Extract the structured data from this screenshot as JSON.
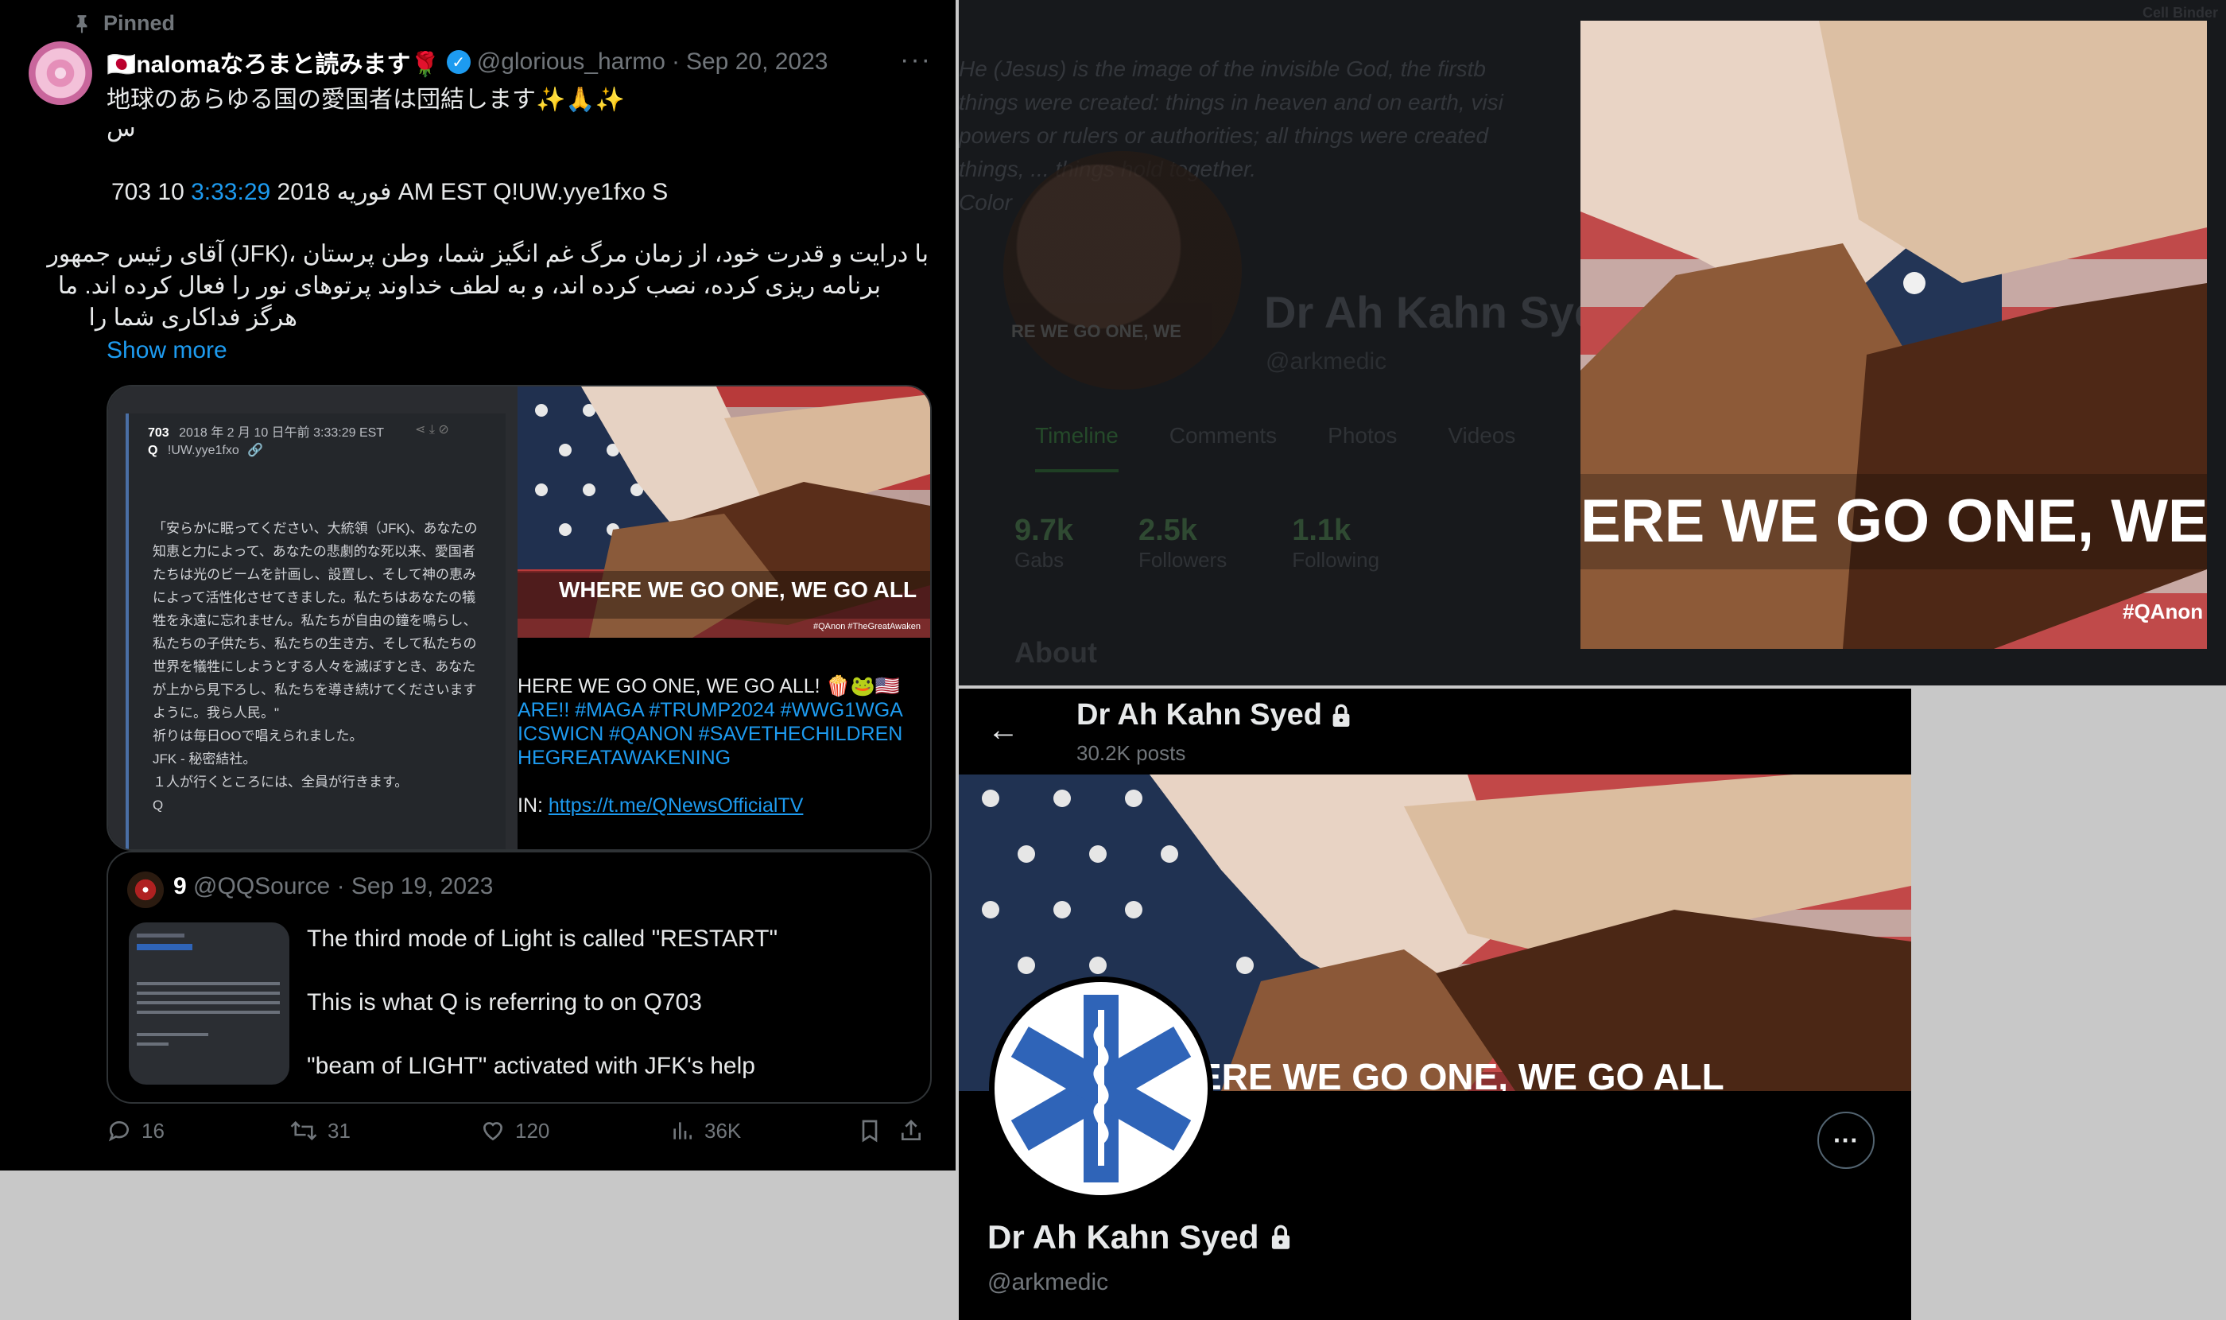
{
  "tweet": {
    "pinned_label": "Pinned",
    "author_name": "🇯🇵nalomaなろまと読みます🌹",
    "handle": "@glorious_harmo",
    "date_sep": "·",
    "date": "Sep 20, 2023",
    "more": "···",
    "line1": "地球のあらゆる国の愛国者は団結します✨🙏✨",
    "line2": "س",
    "line3_pre": "703 10 ",
    "line3_time": "3:33:29",
    "line3_post": " 2018 فوریه AM EST Q!UW.yye1fxo S",
    "persian1": "با درایت و قدرت خود، از زمان مرگ غم انگیز شما، وطن پرستان ،(JFK) آقای رئیس جمهور",
    "persian2": "برنامه ریزی کرده، نصب کرده اند، و به لطف خداوند پرتوهای نور را فعال کرده اند. ما",
    "persian3": "هرگز فداکاری شما را",
    "show_more": "Show more",
    "qdrop": {
      "post_no": "703",
      "timestamp": "2018 年 2 月 10 日午前 3:33:29 EST",
      "author": "Q",
      "trip": "!UW.yye1fxo",
      "lines": [
        "「安らかに眠ってください、大統領（JFK)、あなたの",
        "知恵と力によって、あなたの悲劇的な死以来、愛国者",
        "たちは光のビームを計画し、設置し、そして神の恵み",
        "によって活性化させてきました。私たちはあなたの犠",
        "牲を永遠に忘れません。私たちが自由の鐘を鳴らし、",
        "私たちの子供たち、私たちの生き方、そして私たちの",
        "世界を犠牲にしようとする人々を滅ぼすとき、あなた",
        "が上から見下ろし、私たちを導き続けてくださいます",
        "ように。我ら人民。\"",
        "祈りは毎日OOで唱えられました。",
        "JFK - 秘密結社。",
        "１人が行くところには、全員が行きます。",
        "Q"
      ]
    },
    "image_banner_text": "WHERE WE GO ONE, WE GO ALL",
    "image_watermark": "#QAnon #TheGreatAwaken",
    "caption": [
      "HERE WE GO ONE, WE GO ALL! 🍿🐸🇺🇸",
      "ARE!! #MAGA #TRUMP2024 #WWG1WGA",
      "ICSWICN #QANON #SAVETHECHILDREN",
      "HEGREATAWAKENING"
    ],
    "caption_join": "IN: ",
    "caption_link": "https://t.me/QNewsOfficialTV",
    "quote": {
      "name": "9",
      "handle": "@QQSource",
      "date_sep": "·",
      "date": "Sep 19, 2023",
      "line1": "The third mode of Light is called \"RESTART\"",
      "line2": "This is what Q is referring to on Q703",
      "line3": "\"beam of LIGHT\" activated with JFK's help"
    },
    "actions": {
      "replies": "16",
      "reposts": "31",
      "likes": "120",
      "views": "36K"
    }
  },
  "gab_profile": {
    "corner_text": "Cell Binder",
    "verse_lines": [
      "He (Jesus) is the image of the invisible God, the firstb",
      "things were created: things in heaven and on earth, visi",
      "powers or rulers or authorities; all things were created",
      "things, ... things hold together.",
      "Color"
    ],
    "avatar_text": "RE WE GO ONE, WE",
    "name": "Dr Ah Kahn Sye",
    "handle": "@arkmedic",
    "tabs": [
      "Timeline",
      "Comments",
      "Photos",
      "Videos"
    ],
    "stats": [
      {
        "num": "9.7k",
        "label": "Gabs"
      },
      {
        "num": "2.5k",
        "label": "Followers"
      },
      {
        "num": "1.1k",
        "label": "Following"
      }
    ],
    "about": "About",
    "overlay_banner_text": "ERE WE GO ONE, WE G",
    "overlay_watermark": "#QAnon"
  },
  "x_profile": {
    "back": "←",
    "header_name": "Dr Ah Kahn Syed",
    "posts": "30.2K posts",
    "banner_partial_text": "ERE WE GO ONE, WE GO ALL",
    "name": "Dr Ah Kahn Syed",
    "handle": "@arkmedic",
    "more": "···"
  },
  "colors": {
    "link": "#1d9bf0",
    "star_of_life": "#2f64b8"
  }
}
